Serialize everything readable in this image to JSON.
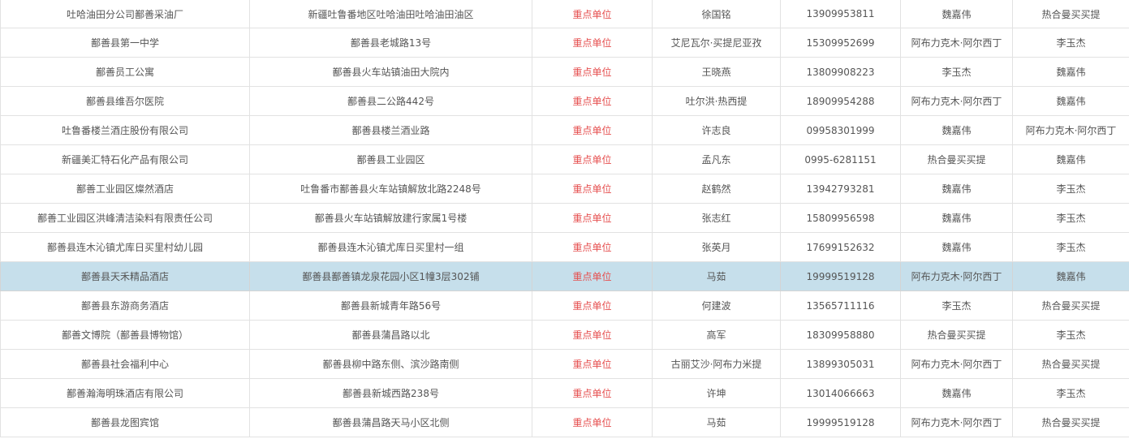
{
  "table": {
    "rows": [
      {
        "name": "吐哈油田分公司鄯善采油厂",
        "address": "新疆吐鲁番地区吐哈油田吐哈油田油区",
        "level": "重点单位",
        "contact": "徐国铭",
        "phone": "13909953811",
        "leader1": "魏嘉伟",
        "leader2": "热合曼买买提",
        "selected": false
      },
      {
        "name": "鄯善县第一中学",
        "address": "鄯善县老城路13号",
        "level": "重点单位",
        "contact": "艾尼瓦尔·买提尼亚孜",
        "phone": "15309952699",
        "leader1": "阿布力克木·阿尔西丁",
        "leader2": "李玉杰",
        "selected": false
      },
      {
        "name": "鄯善员工公寓",
        "address": "鄯善县火车站镇油田大院内",
        "level": "重点单位",
        "contact": "王晓燕",
        "phone": "13809908223",
        "leader1": "李玉杰",
        "leader2": "魏嘉伟",
        "selected": false
      },
      {
        "name": "鄯善县维吾尔医院",
        "address": "鄯善县二公路442号",
        "level": "重点单位",
        "contact": "吐尔洪·热西提",
        "phone": "18909954288",
        "leader1": "阿布力克木·阿尔西丁",
        "leader2": "魏嘉伟",
        "selected": false
      },
      {
        "name": "吐鲁番楼兰酒庄股份有限公司",
        "address": "鄯善县楼兰酒业路",
        "level": "重点单位",
        "contact": "许志良",
        "phone": "09958301999",
        "leader1": "魏嘉伟",
        "leader2": "阿布力克木·阿尔西丁",
        "selected": false
      },
      {
        "name": "新疆美汇特石化产品有限公司",
        "address": "鄯善县工业园区",
        "level": "重点单位",
        "contact": "孟凡东",
        "phone": "0995-6281151",
        "leader1": "热合曼买买提",
        "leader2": "魏嘉伟",
        "selected": false
      },
      {
        "name": "鄯善工业园区燦然酒店",
        "address": "吐鲁番市鄯善县火车站镇解放北路2248号",
        "level": "重点单位",
        "contact": "赵鹤然",
        "phone": "13942793281",
        "leader1": "魏嘉伟",
        "leader2": "李玉杰",
        "selected": false
      },
      {
        "name": "鄯善工业园区洪峰清洁染料有限责任公司",
        "address": "鄯善县火车站镇解放建行家属1号楼",
        "level": "重点单位",
        "contact": "张志红",
        "phone": "15809956598",
        "leader1": "魏嘉伟",
        "leader2": "李玉杰",
        "selected": false
      },
      {
        "name": "鄯善县连木沁镇尤库日买里村幼儿园",
        "address": "鄯善县连木沁镇尤库日买里村一组",
        "level": "重点单位",
        "contact": "张英月",
        "phone": "17699152632",
        "leader1": "魏嘉伟",
        "leader2": "李玉杰",
        "selected": false
      },
      {
        "name": "鄯善县天禾精品酒店",
        "address": "鄯善县鄯善镇龙泉花园小区1幢3层302铺",
        "level": "重点单位",
        "contact": "马茹",
        "phone": "19999519128",
        "leader1": "阿布力克木·阿尔西丁",
        "leader2": "魏嘉伟",
        "selected": true
      },
      {
        "name": "鄯善县东游商务酒店",
        "address": "鄯善县新城青年路56号",
        "level": "重点单位",
        "contact": "何建波",
        "phone": "13565711116",
        "leader1": "李玉杰",
        "leader2": "热合曼买买提",
        "selected": false
      },
      {
        "name": "鄯善文博院（鄯善县博物馆）",
        "address": "鄯善县蒲昌路以北",
        "level": "重点单位",
        "contact": "高军",
        "phone": "18309958880",
        "leader1": "热合曼买买提",
        "leader2": "李玉杰",
        "selected": false
      },
      {
        "name": "鄯善县社会福利中心",
        "address": "鄯善县柳中路东侧、滨沙路南侧",
        "level": "重点单位",
        "contact": "古丽艾沙·阿布力米提",
        "phone": "13899305031",
        "leader1": "阿布力克木·阿尔西丁",
        "leader2": "热合曼买买提",
        "selected": false
      },
      {
        "name": "鄯善瀚海明珠酒店有限公司",
        "address": "鄯善县新城西路238号",
        "level": "重点单位",
        "contact": "许坤",
        "phone": "13014066663",
        "leader1": "魏嘉伟",
        "leader2": "李玉杰",
        "selected": false
      },
      {
        "name": "鄯善县龙图宾馆",
        "address": "鄯善县蒲昌路天马小区北侧",
        "level": "重点单位",
        "contact": "马茹",
        "phone": "19999519128",
        "leader1": "阿布力克木·阿尔西丁",
        "leader2": "热合曼买买提",
        "selected": false
      }
    ]
  },
  "colors": {
    "level_text": "#e65050",
    "selected_row": "#c6dfeb",
    "text": "#555555",
    "border": "#e2e2e2"
  }
}
